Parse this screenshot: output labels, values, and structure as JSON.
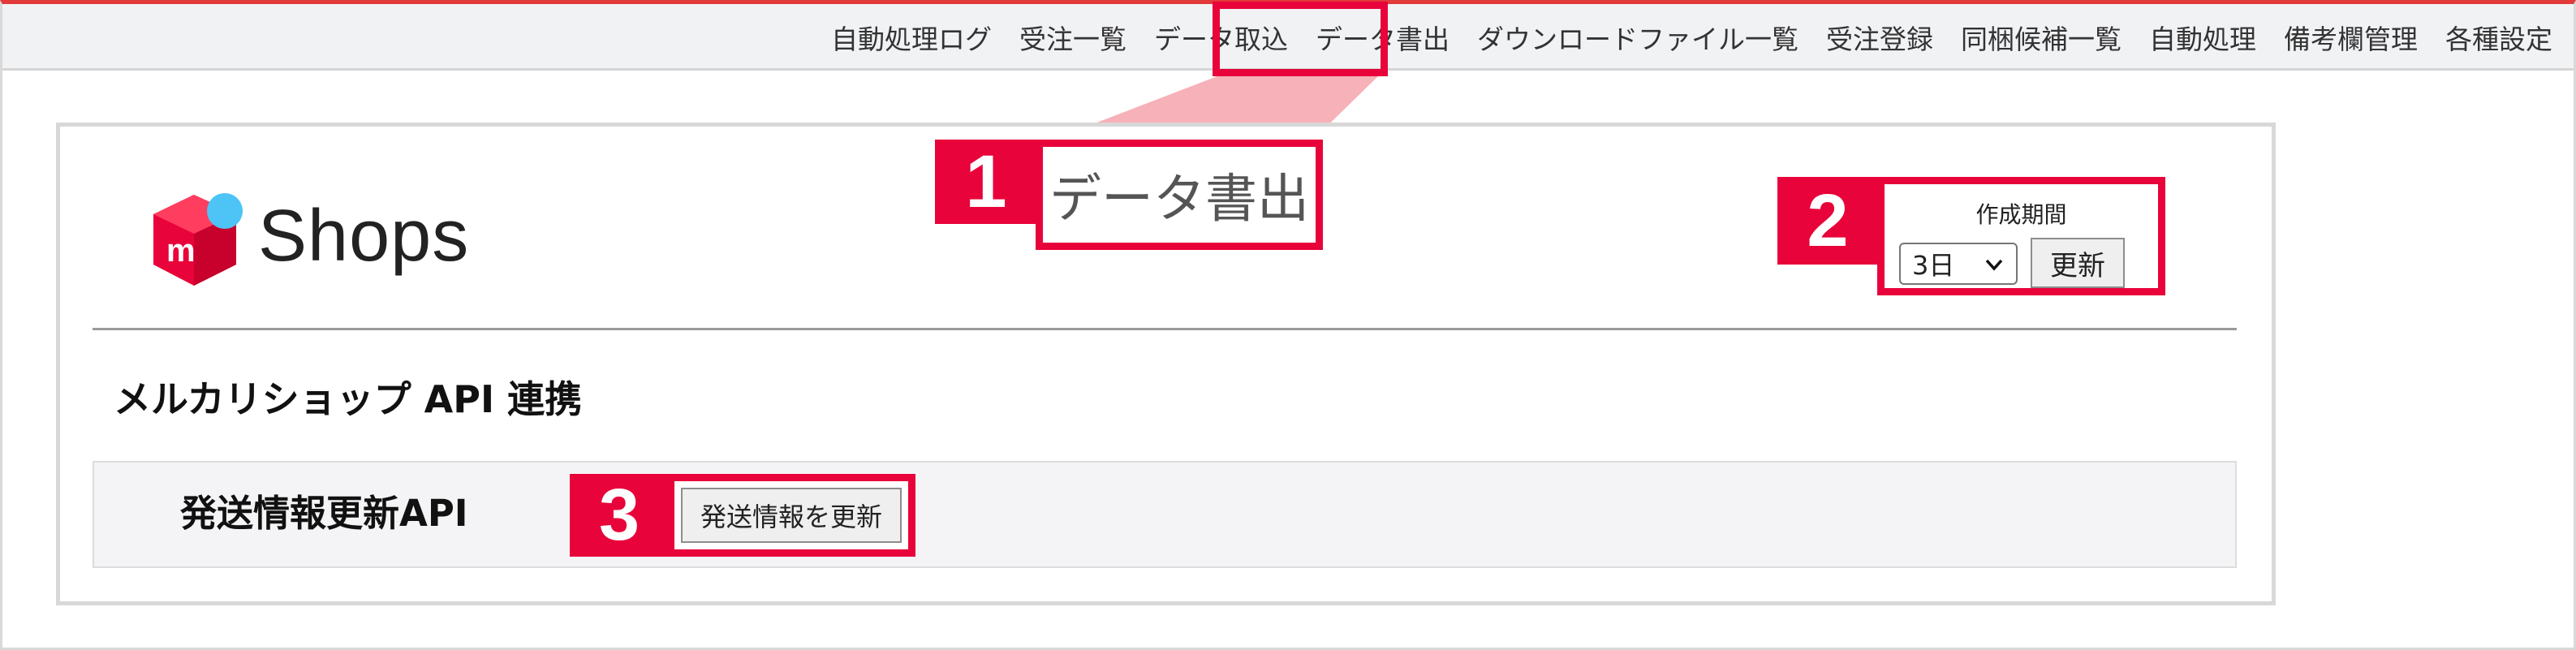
{
  "nav": {
    "items": [
      {
        "label": "自動処理ログ"
      },
      {
        "label": "受注一覧"
      },
      {
        "label": "データ取込"
      },
      {
        "label": "データ書出"
      },
      {
        "label": "ダウンロードファイル一覧"
      },
      {
        "label": "受注登録"
      },
      {
        "label": "同梱候補一覧"
      },
      {
        "label": "自動処理"
      },
      {
        "label": "備考欄管理"
      },
      {
        "label": "各種設定"
      }
    ]
  },
  "brand": {
    "logo_text": "Shops",
    "logo_letter": "m"
  },
  "page": {
    "title": "データ書出"
  },
  "period": {
    "label": "作成期間",
    "selected": "3日",
    "update_label": "更新"
  },
  "section": {
    "title": "メルカリショップ API 連携"
  },
  "api": {
    "label": "発送情報更新API",
    "button_label": "発送情報を更新"
  },
  "annotations": {
    "step1": "1",
    "step2": "2",
    "step3": "3"
  },
  "colors": {
    "accent_red": "#e8033a",
    "logo_red": "#e8033a",
    "logo_blue": "#4dc4f5",
    "topbar_line": "#e23a3a"
  }
}
